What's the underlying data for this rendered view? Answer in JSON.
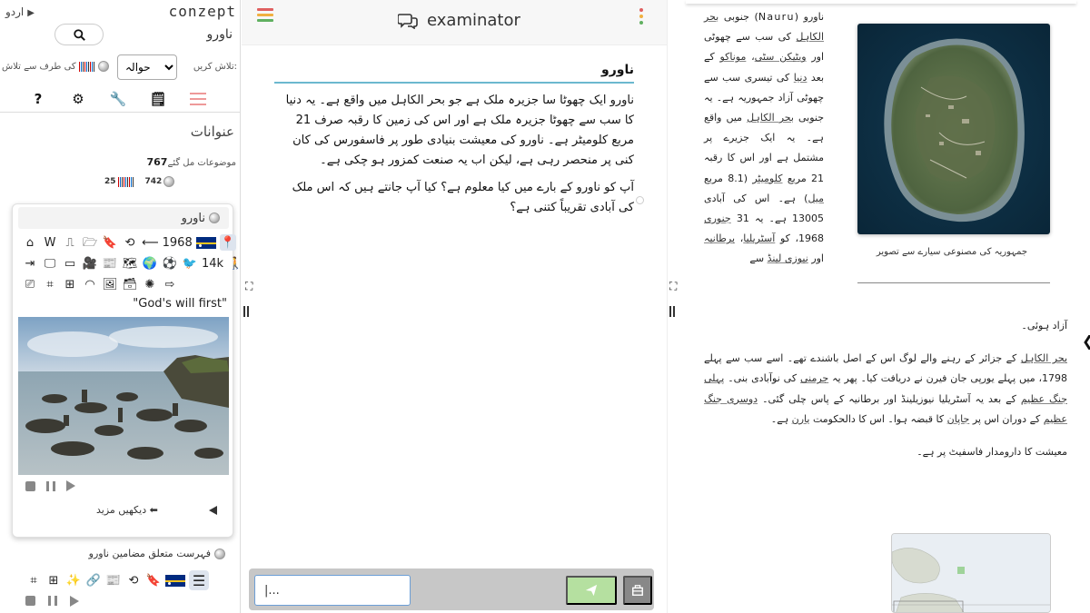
{
  "sidebar": {
    "language_label": "اردو",
    "brand": "conzept",
    "current_topic": "ناورو",
    "search_from_label": "کی طرف سے تلاش",
    "search_select_value": "حوالہ",
    "search_label": "تلاش کریں:",
    "topics_heading": "عنوانات",
    "found_count": "767",
    "found_label": "موضوعات مل گئے",
    "count_wikidata": "25",
    "count_wikipedia": "742",
    "card": {
      "title": "ناورو",
      "year_label": "1968",
      "population": "14k",
      "motto": "\"God's will first\"",
      "see_more": "دیکھیں مزید"
    },
    "related_label": "فہرست متعلق مضامین ناورو"
  },
  "chat": {
    "app_name": "examinator",
    "heading": "ناورو",
    "paragraph_1": "ناورو ایک چھوٹا سا جزیرہ ملک ہے جو بحر الکاہل میں واقع ہے۔ یہ دنیا کا سب سے چھوٹا جزیرہ ملک ہے اور اس کی زمین کا رقبہ صرف 21 مربع کلومیٹر ہے۔ ناورو کی معیشت بنیادی طور پر فاسفورس کی کان کنی پر منحصر رہی ہے، لیکن اب یہ صنعت کمزور ہو چکی ہے۔",
    "paragraph_2": "آپ کو ناورو کے بارے میں کیا معلوم ہے؟ کیا آپ جانتے ہیں کہ اس ملک کی آبادی تقریباً کتنی ہے؟",
    "input_value": "|...",
    "colors": {
      "ham_1": "#e06060",
      "ham_2": "#f0b040",
      "ham_3": "#60b060",
      "send": "#b5e0a0"
    }
  },
  "article": {
    "p1_a": "ناورو (Nauru) جنوبی",
    "p1_link1": "بحر الکاہل",
    "p1_b": "کی سب سے چھوٹی اور",
    "p1_link2": "ویٹیکن سٹی",
    "p1_c": "،",
    "p1_link3": "موناکو",
    "p1_d": "کے بعد",
    "p1_link4": "دنیا",
    "p1_e": "کی تیسری سب سے چھوٹی آزاد جمہوریہ ہے۔ یہ جنوبی",
    "p1_link5": "بحر الکاہل",
    "p1_f": "میں واقع ہے۔ یہ ایک جزیرے پر مشتمل ہے اور اس کا رقبہ 21 مربع",
    "p1_link6": "کلومیٹر",
    "p1_g": "(8.1 مربع",
    "p1_link7": "میل",
    "p1_h": ") ہے۔ اس کی آبادی 13005 ہے۔ یہ 31",
    "p1_link8": "جنوری",
    "p1_i": "1968، کو",
    "p1_link9": "آسٹریلیا",
    "p1_j": "،",
    "p1_link10": "برطانیہ",
    "p1_k": "اور",
    "p1_link11": "نیوزی لینڈ",
    "p1_l": "سے",
    "p1_end": "آزاد ہوئی۔",
    "figure_caption": "جمہوریہ کی مصنوعی سیارے سے تصویر",
    "p2_link1": "بحر الکاہل",
    "p2_a": "کے جزائر کے رہنے والے لوگ اس کے اصل باشندے تھے۔ اسے سب سے پہلے 1798، میں پہلے یورپی جان فیرن نے دریافت کیا۔ پھر یہ",
    "p2_link2": "جرمنی",
    "p2_b": "کی نوآبادی بنی۔",
    "p2_link3": "پہلی جنگ عظیم",
    "p2_c": "کے بعد یہ آسٹریلیا نیوزیلینڈ اور برطانیہ کے پاس چلی گئی۔",
    "p2_link4": "دوسری جنگ عظیم",
    "p2_d": "کے دوران اس پر",
    "p2_link5": "جاپان",
    "p2_e": "کا قبضہ ہوا۔ اس کا دالحکومت",
    "p2_link6": "یارن",
    "p2_f": "ہے۔",
    "p3": "معیشت کا دارومدار فاسفیٹ پر ہے۔"
  }
}
